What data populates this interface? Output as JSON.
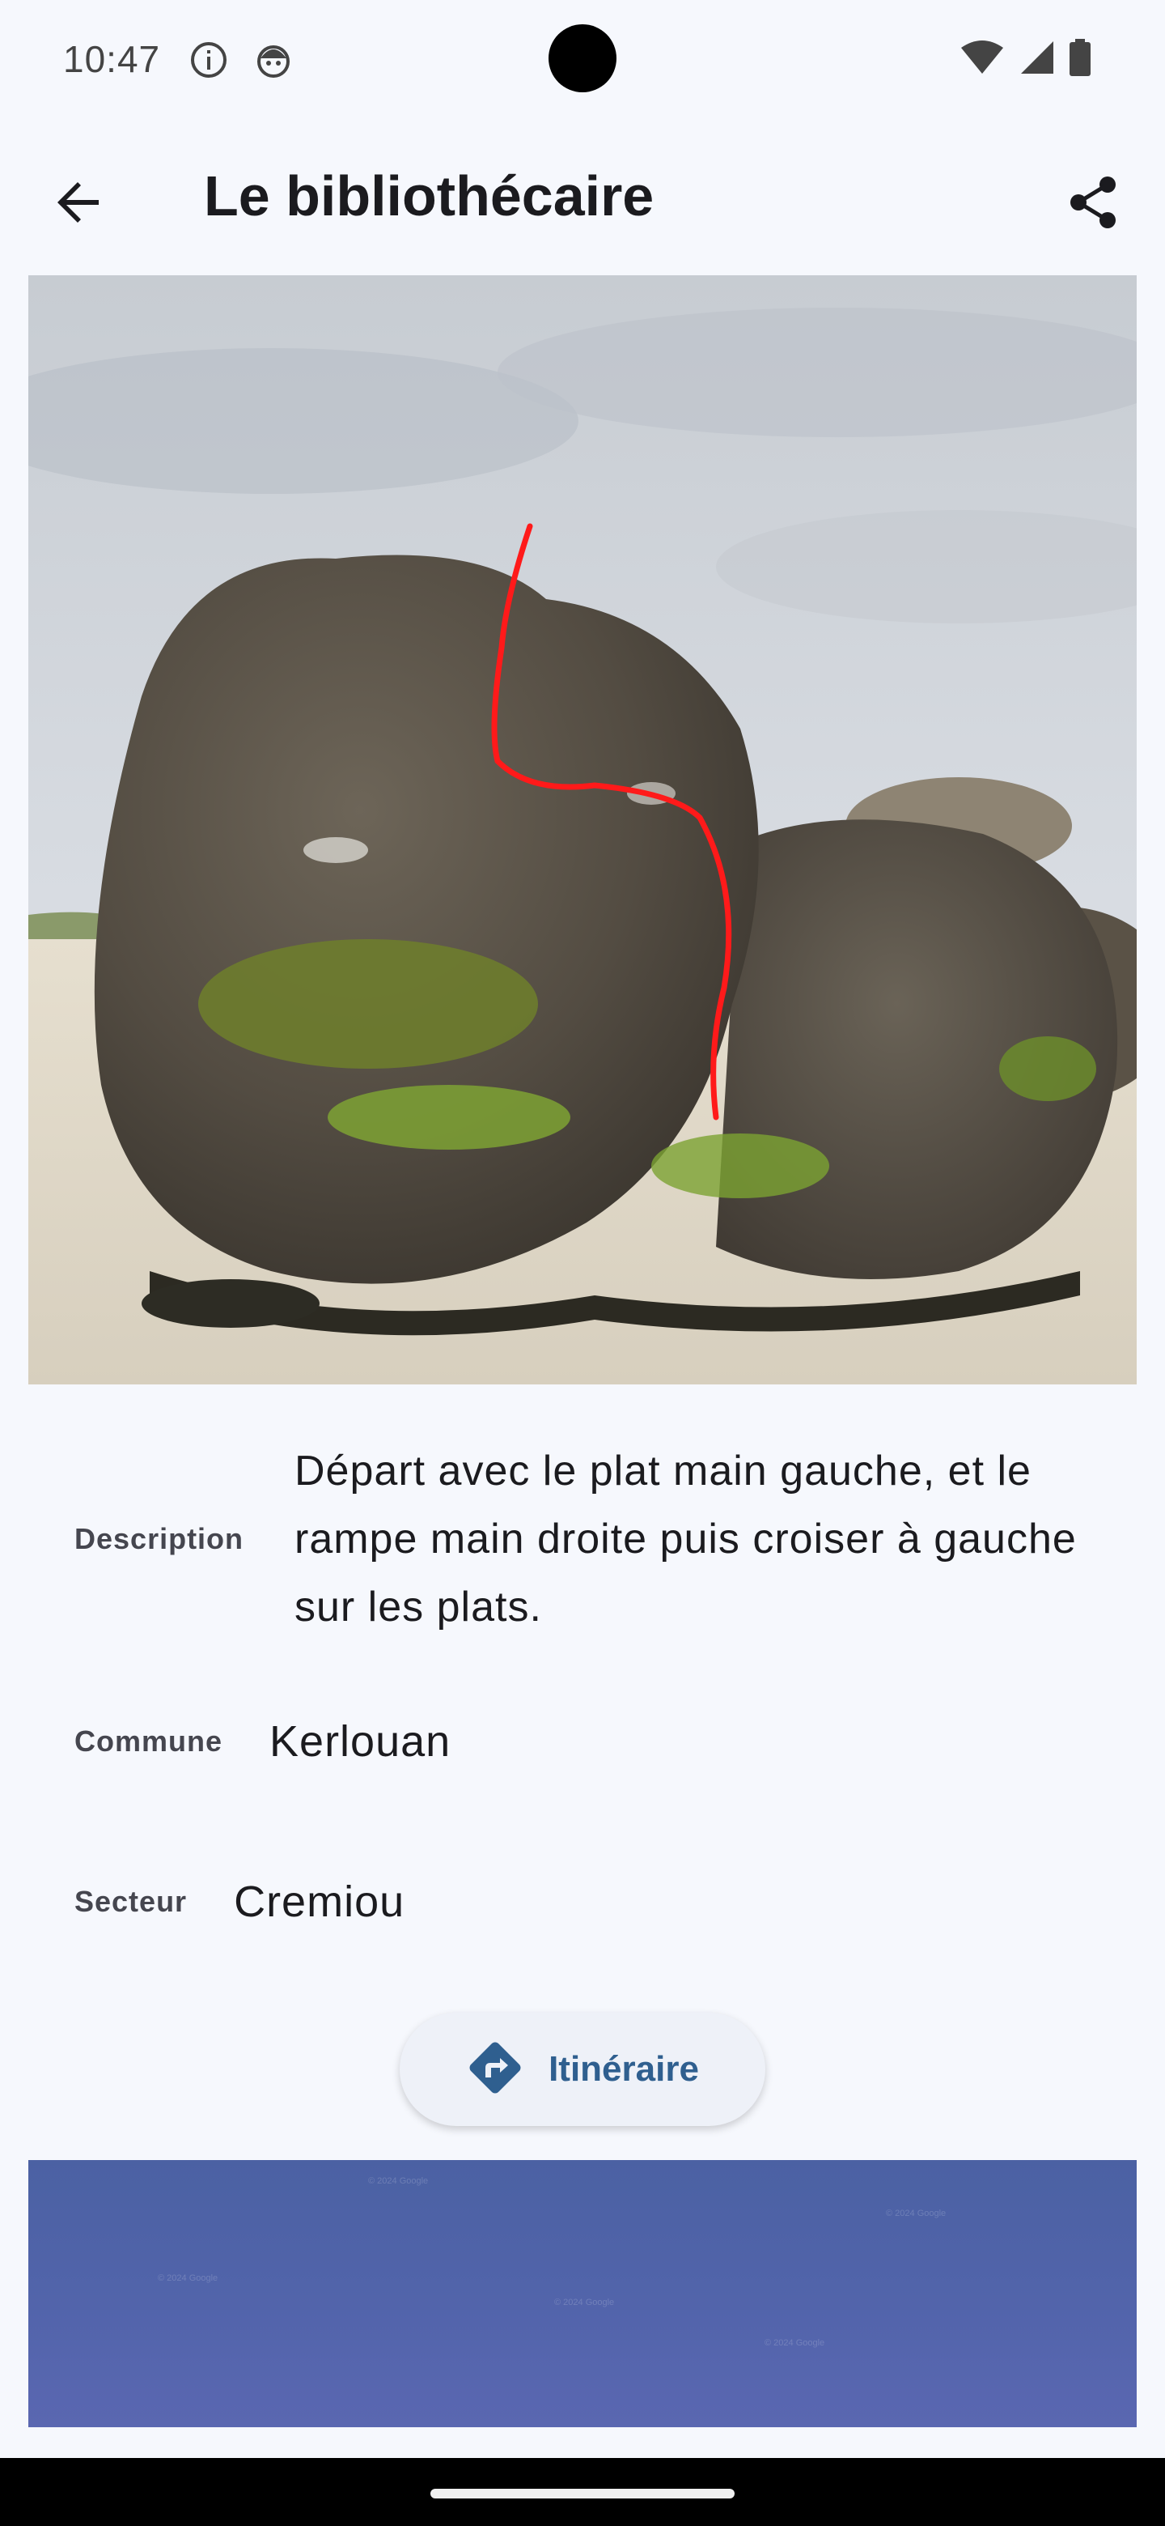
{
  "status_bar": {
    "time": "10:47",
    "icons": [
      "info-icon",
      "face-icon",
      "wifi-icon",
      "signal-icon",
      "battery-icon"
    ]
  },
  "header": {
    "title": "Le bibliothécaire",
    "back_icon": "arrow-back-icon",
    "share_icon": "share-icon"
  },
  "photo": {
    "subject": "boulder-on-beach-with-red-route-line",
    "route_color": "#ff1a1a"
  },
  "details": {
    "description_label": "Description",
    "description_value": "Départ avec le plat main gauche, et le rampe main droite puis croiser à gauche sur les plats.",
    "commune_label": "Commune",
    "commune_value": "Kerlouan",
    "secteur_label": "Secteur",
    "secteur_value": "Cremiou"
  },
  "itinerary": {
    "label": "Itinéraire",
    "icon": "directions-icon",
    "accent": "#2f5f8f"
  },
  "map": {
    "watermark": "© 2024 Google"
  },
  "colors": {
    "background": "#f6f8fd",
    "map_tint": "#4f63a8"
  }
}
